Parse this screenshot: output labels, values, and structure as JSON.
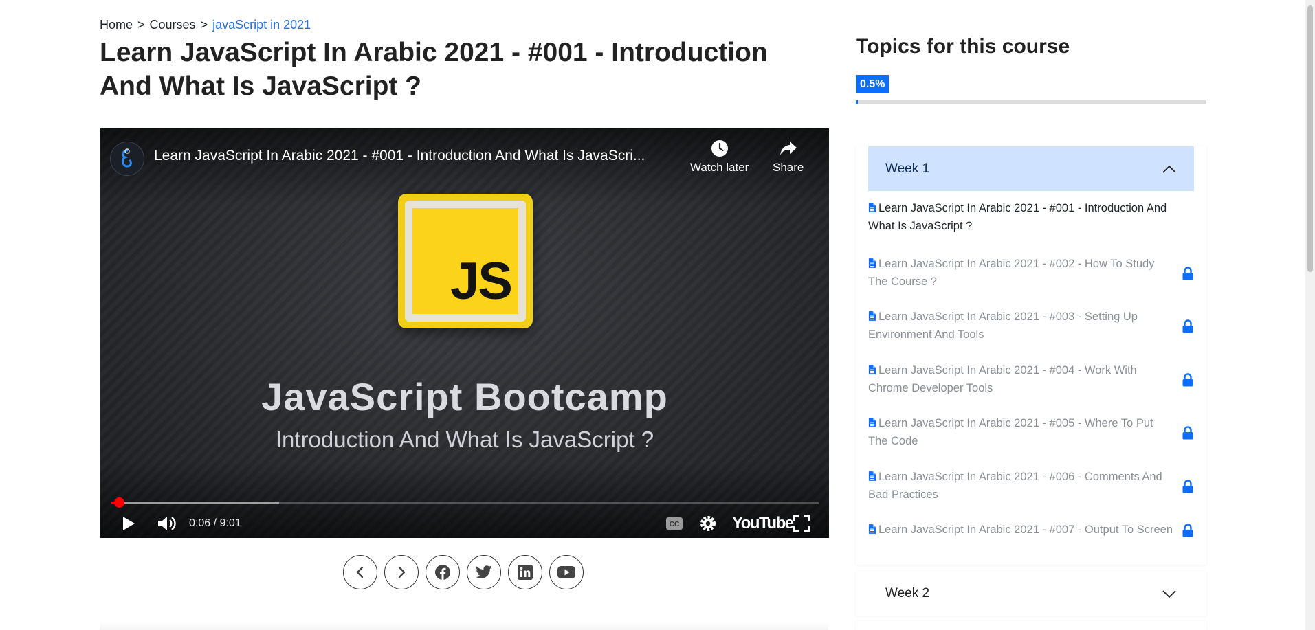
{
  "breadcrumb": {
    "home": "Home",
    "separator": ">",
    "courses": "Courses",
    "current": "javaScript in 2021"
  },
  "page_title": "Learn JavaScript In Arabic 2021 - #001 - Introduction And What Is JavaScript ?",
  "player": {
    "video_title": "Learn JavaScript In Arabic 2021 - #001 - Introduction And What Is JavaScri...",
    "watch_later_label": "Watch later",
    "share_label": "Share",
    "thumbnail_logo_text": "JS",
    "thumbnail_title": "JavaScript Bootcamp",
    "thumbnail_subtitle": "Introduction And What Is JavaScript ?",
    "time": "0:06 / 9:01",
    "played_fraction": 0.011,
    "buffered_fraction": 0.237,
    "brand": "YouTube",
    "accent_color": "#ff0000"
  },
  "share_buttons": [
    {
      "icon": "chevron-left-icon"
    },
    {
      "icon": "chevron-right-icon"
    },
    {
      "icon": "facebook-icon"
    },
    {
      "icon": "twitter-icon"
    },
    {
      "icon": "linkedin-icon"
    },
    {
      "icon": "youtube-icon"
    }
  ],
  "sidebar": {
    "title": "Topics for this course",
    "progress_label": "0.5%",
    "progress_value": 0.005,
    "accent_color": "#0d6efd",
    "weeks": [
      {
        "label": "Week 1",
        "expanded": true,
        "lessons": [
          {
            "title": "Learn JavaScript In Arabic 2021 - #001 - Introduction And What Is JavaScript ?",
            "locked": false
          },
          {
            "title": "Learn JavaScript In Arabic 2021 - #002 - How To Study The Course ?",
            "locked": true
          },
          {
            "title": "Learn JavaScript In Arabic 2021 - #003 - Setting Up Environment And Tools",
            "locked": true
          },
          {
            "title": "Learn JavaScript In Arabic 2021 - #004 - Work With Chrome Developer Tools",
            "locked": true
          },
          {
            "title": "Learn JavaScript In Arabic 2021 - #005 - Where To Put The Code",
            "locked": true
          },
          {
            "title": "Learn JavaScript In Arabic 2021 - #006 - Comments And Bad Practices",
            "locked": true
          },
          {
            "title": "Learn JavaScript In Arabic 2021 - #007 - Output To Screen",
            "locked": true
          }
        ]
      },
      {
        "label": "Week 2",
        "expanded": false
      }
    ]
  }
}
